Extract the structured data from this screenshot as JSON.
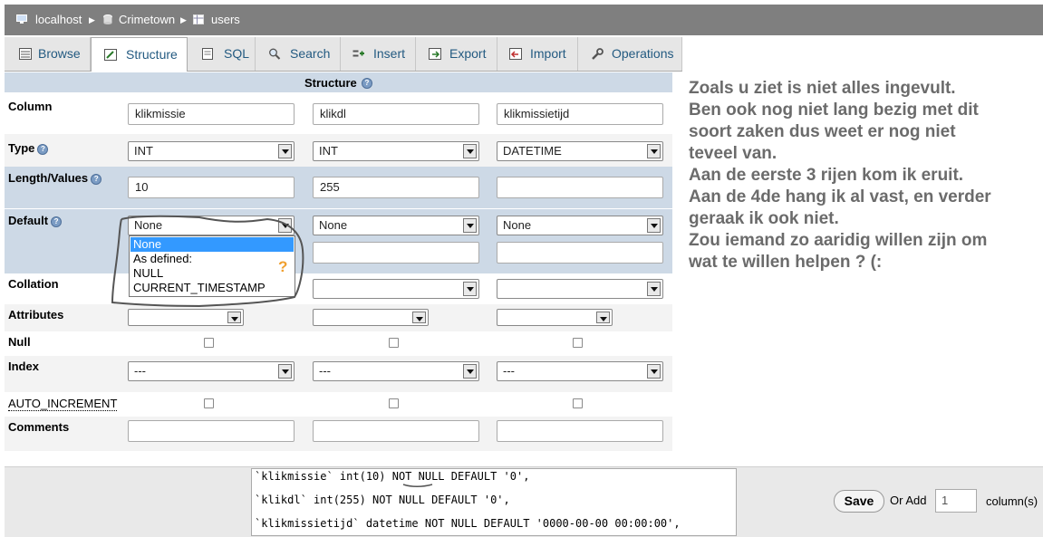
{
  "breadcrumb": {
    "items": [
      {
        "label": "localhost",
        "icon": "server-icon"
      },
      {
        "label": "Crimetown",
        "icon": "database-icon"
      },
      {
        "label": "users",
        "icon": "table-icon"
      }
    ]
  },
  "tabs": [
    {
      "label": "Browse",
      "icon": "browse-icon"
    },
    {
      "label": "Structure",
      "icon": "structure-icon",
      "active": true
    },
    {
      "label": "SQL",
      "icon": "sql-icon"
    },
    {
      "label": "Search",
      "icon": "search-icon"
    },
    {
      "label": "Insert",
      "icon": "insert-icon"
    },
    {
      "label": "Export",
      "icon": "export-icon"
    },
    {
      "label": "Import",
      "icon": "import-icon"
    },
    {
      "label": "Operations",
      "icon": "operations-icon"
    }
  ],
  "form": {
    "header": "Structure",
    "labels": {
      "column": "Column",
      "type": "Type",
      "length": "Length/Values",
      "default": "Default",
      "collation": "Collation",
      "attributes": "Attributes",
      "null": "Null",
      "index": "Index",
      "auto_increment": "AUTO_INCREMENT",
      "comments": "Comments"
    },
    "columns": [
      {
        "name": "klikmissie",
        "type": "INT",
        "length": "10",
        "default": "None",
        "index": "---"
      },
      {
        "name": "klikdl",
        "type": "INT",
        "length": "255",
        "default": "None",
        "index": "---"
      },
      {
        "name": "klikmissietijd",
        "type": "DATETIME",
        "length": "",
        "default": "None",
        "index": "---"
      }
    ],
    "default_options": [
      "None",
      "As defined:",
      "NULL",
      "CURRENT_TIMESTAMP"
    ],
    "annotation_mark": "?"
  },
  "commentary": {
    "lines": [
      "Zoals u ziet is niet alles ingevult.",
      "Ben ook nog niet lang bezig met dit",
      "soort zaken dus weet er nog niet",
      "teveel van.",
      "Aan de eerste 3 rijen kom ik eruit.",
      "Aan de 4de hang ik al vast, en verder",
      "geraak ik ook niet.",
      "Zou iemand zo aaridig willen zijn om",
      "wat te willen helpen ? (:"
    ]
  },
  "sql": {
    "lines": [
      "`klikmissie` int(10) NOT NULL DEFAULT '0',",
      "`klikdl` int(255) NOT NULL DEFAULT '0',",
      "`klikmissietijd` datetime NOT NULL DEFAULT '0000-00-00 00:00:00',"
    ]
  },
  "footer": {
    "save_label": "Save",
    "or_add_label": "Or Add",
    "add_count": "1",
    "columns_label": "column(s)"
  },
  "colors": {
    "breadcrumb_bg": "#7f7f7f",
    "tab_text": "#235a81",
    "highlight_row": "#cdd9e6",
    "selected_option": "#3399ff",
    "commentary_text": "#6b6b6b",
    "scribble": "#555555",
    "question_mark": "#f0a030"
  }
}
